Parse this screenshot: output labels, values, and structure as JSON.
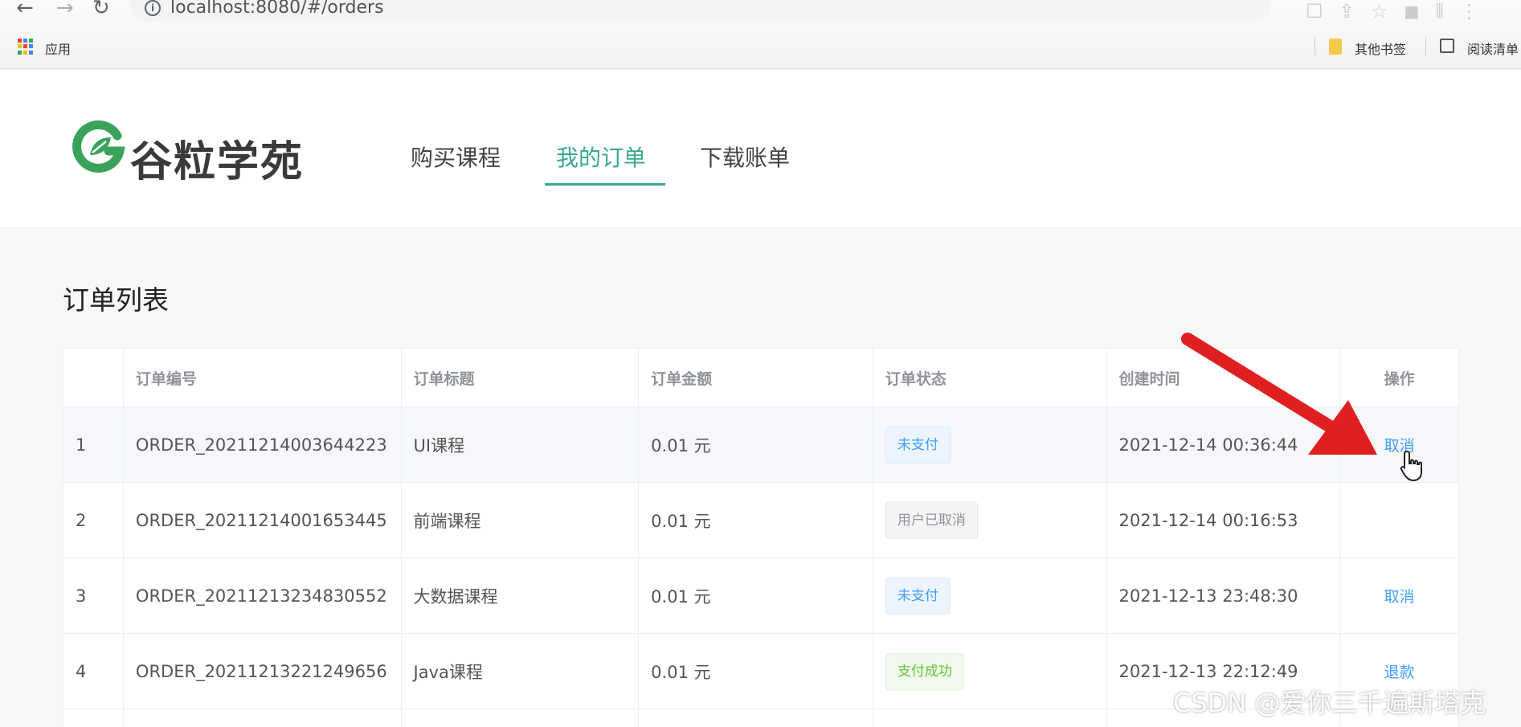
{
  "browser": {
    "back_glyph": "←",
    "forward_glyph": "→",
    "reload_glyph": "↻",
    "info_glyph": "i",
    "url": "localhost:8080/#/orders",
    "bookmarks": {
      "apps_label": "应用",
      "other_bookmarks": "其他书签",
      "reading_list": "阅读清单"
    }
  },
  "site": {
    "logo_text": "谷粒学苑",
    "nav": [
      "购买课程",
      "我的订单",
      "下载账单"
    ],
    "active_nav_index": 1,
    "accent_color": "#3aa891"
  },
  "page_title": "订单列表",
  "table": {
    "headers": [
      "",
      "订单编号",
      "订单标题",
      "订单金额",
      "订单状态",
      "创建时间",
      "操作"
    ],
    "rows": [
      {
        "index": "1",
        "order_no": "ORDER_20211214003644223",
        "title": "UI课程",
        "amount": "0.01 元",
        "status": "未支付",
        "status_type": "unpaid",
        "created": "2021-12-14 00:36:44",
        "action": "取消"
      },
      {
        "index": "2",
        "order_no": "ORDER_20211214001653445",
        "title": "前端课程",
        "amount": "0.01 元",
        "status": "用户已取消",
        "status_type": "cancelled",
        "created": "2021-12-14 00:16:53",
        "action": ""
      },
      {
        "index": "3",
        "order_no": "ORDER_20211213234830552",
        "title": "大数据课程",
        "amount": "0.01 元",
        "status": "未支付",
        "status_type": "unpaid",
        "created": "2021-12-13 23:48:30",
        "action": "取消"
      },
      {
        "index": "4",
        "order_no": "ORDER_20211213221249656",
        "title": "Java课程",
        "amount": "0.01 元",
        "status": "支付成功",
        "status_type": "paid",
        "created": "2021-12-13 22:12:49",
        "action": "退款"
      }
    ]
  },
  "watermark": "CSDN @爱你三千遍斯塔克"
}
